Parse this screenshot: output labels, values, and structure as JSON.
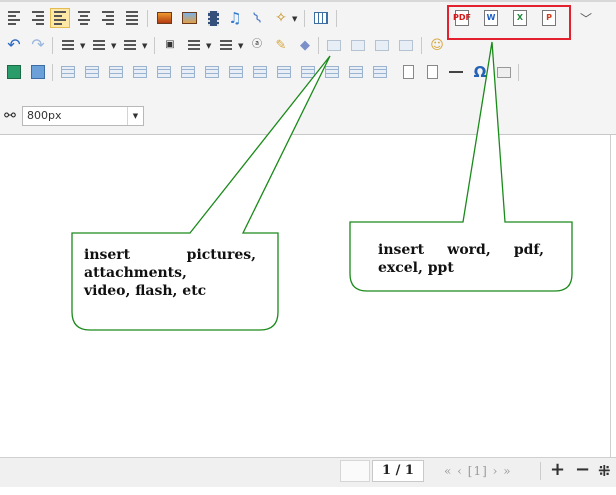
{
  "toolbar": {
    "row1": [
      {
        "icon": "indent-icon"
      },
      {
        "icon": "outdent-icon"
      },
      {
        "icon": "align-left-icon",
        "active": true
      },
      {
        "icon": "align-center-icon"
      },
      {
        "icon": "align-right-icon"
      },
      {
        "icon": "align-justify-icon"
      },
      {
        "icon": "insert-image-icon"
      },
      {
        "icon": "insert-image-alt-icon"
      },
      {
        "icon": "insert-video-icon"
      },
      {
        "icon": "insert-music-icon"
      },
      {
        "icon": "attachment-icon"
      },
      {
        "icon": "magic-wand-icon"
      },
      {
        "icon": "insert-table-icon"
      },
      {
        "icon": "insert-pdf-icon"
      },
      {
        "icon": "insert-word-icon"
      },
      {
        "icon": "insert-excel-icon"
      },
      {
        "icon": "insert-ppt-icon"
      },
      {
        "icon": "chevron-down-icon"
      }
    ],
    "doc_icon_letters": {
      "pdf": "PDF",
      "word": "W",
      "excel": "X",
      "ppt": "P"
    },
    "zoom_select": {
      "value": "800px"
    },
    "highlight_color": "#e2202e",
    "active_color": "#fde8a6"
  },
  "status_bar": {
    "page_indicator": "1 / 1",
    "pager": "« ‹ [1] › »",
    "zoom_in": "+",
    "zoom_out": "−",
    "zoom_fit": "⁜"
  },
  "annotations": [
    {
      "lines": [
        [
          "insert",
          "pictures,"
        ],
        [
          "attachments,"
        ],
        [
          "video, flash, etc"
        ]
      ]
    },
    {
      "lines": [
        [
          "insert",
          "word,",
          "pdf,"
        ],
        [
          "excel, ppt"
        ]
      ]
    }
  ],
  "colors": {
    "callout_stroke": "#1a8a1a",
    "toolbar_bg": "#f4f4f4"
  }
}
